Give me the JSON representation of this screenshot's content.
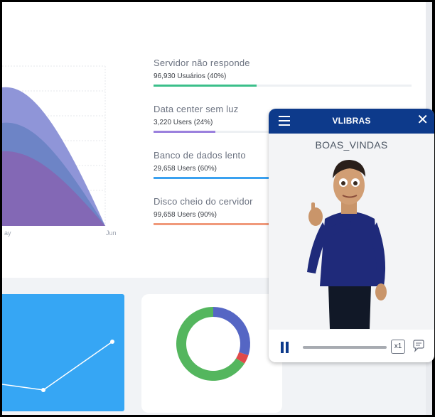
{
  "progress": {
    "items": [
      {
        "title": "Servidor não responde",
        "subtitle": "96,930 Usuários (40%)",
        "percent": 40,
        "color": "#3bbf8a"
      },
      {
        "title": "Data center sem luz",
        "subtitle": "3,220 Users (24%)",
        "percent": 24,
        "color": "#9a80dd"
      },
      {
        "title": "Banco de dados lento",
        "subtitle": "29,658 Users (60%)",
        "percent": 60,
        "color": "#3aa1f0"
      },
      {
        "title": "Disco cheio do cervidor",
        "subtitle": "99,658 Users (90%)",
        "percent": 90,
        "color": "#f0997a"
      }
    ]
  },
  "chart_data": [
    {
      "type": "area",
      "categories": [
        "May",
        "Jun"
      ],
      "x_tick_labels_visible": [
        "ay",
        "Jun"
      ],
      "series_colors": [
        "#8f95d8",
        "#6d84c6",
        "#8368b5"
      ],
      "grid": true
    },
    {
      "type": "line",
      "x": [
        1,
        2,
        3
      ],
      "values": [
        2,
        1,
        4
      ],
      "line_color": "#ffffff",
      "background": "#36a6f4"
    },
    {
      "type": "pie",
      "donut": true,
      "values": [
        30,
        4,
        66
      ],
      "colors": [
        "#5566c4",
        "#e04a4a",
        "#54b65e"
      ]
    }
  ],
  "vlibras": {
    "title": "VLIBRAS",
    "caption": "BOAS_VINDAS",
    "speed": "x1",
    "icons": {
      "menu": "menu-icon",
      "close": "close-icon",
      "pause": "pause-icon",
      "subtitles": "speech-bubble-icon"
    }
  }
}
